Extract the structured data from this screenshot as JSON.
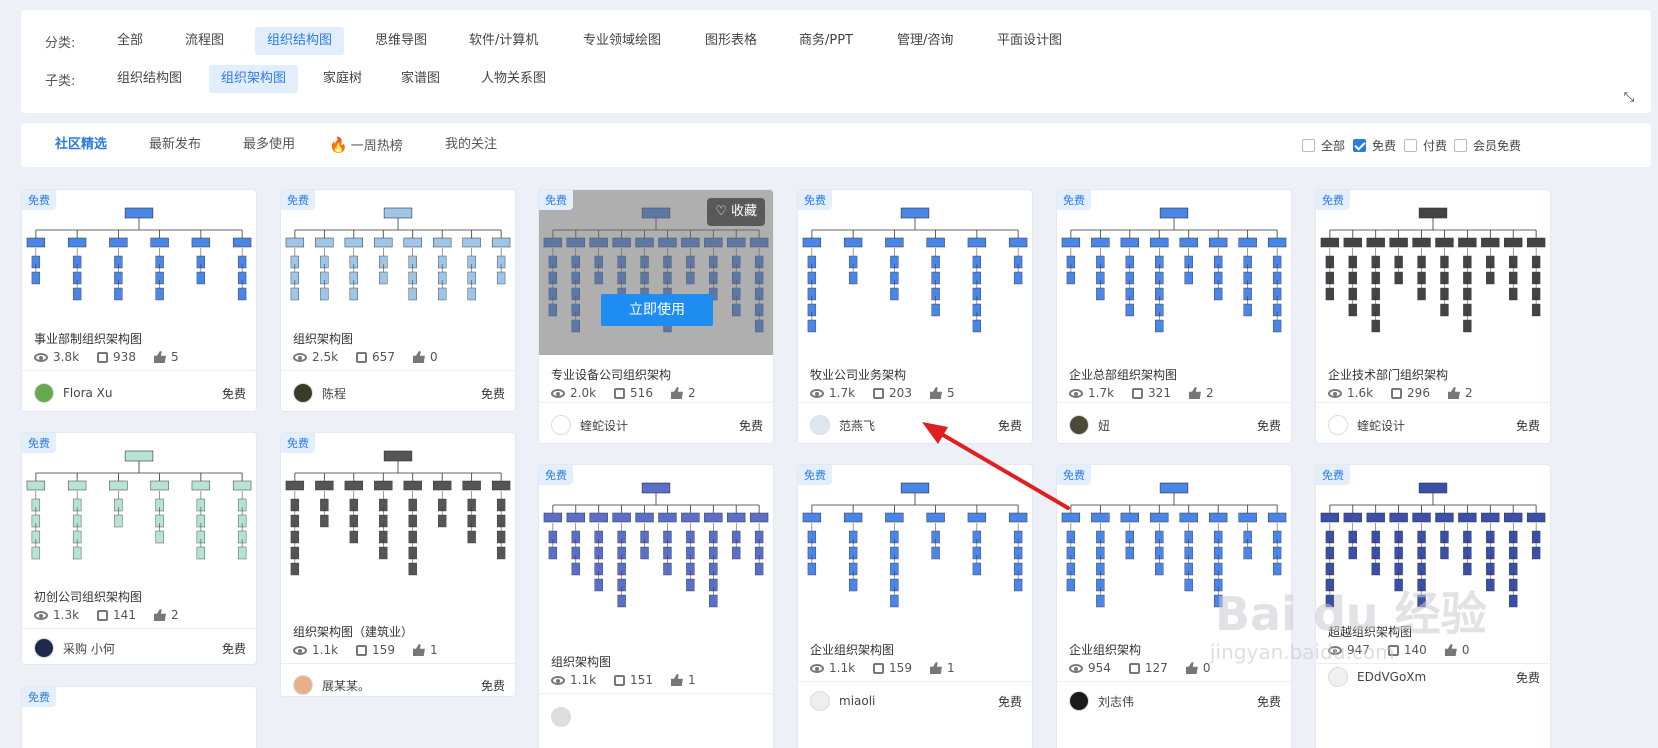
{
  "filter": {
    "category_label": "分类:",
    "categories": [
      "全部",
      "流程图",
      "组织结构图",
      "思维导图",
      "软件/计算机",
      "专业领域绘图",
      "图形表格",
      "商务/PPT",
      "管理/咨询",
      "平面设计图"
    ],
    "sub_label": "子类:",
    "subcategories": [
      "组织结构图",
      "组织架构图",
      "家庭树",
      "家谱图",
      "人物关系图"
    ]
  },
  "tabs": [
    "社区精选",
    "最新发布",
    "最多使用",
    "一周热榜",
    "我的关注"
  ],
  "checks": [
    {
      "label": "全部",
      "checked": false
    },
    {
      "label": "免费",
      "checked": true
    },
    {
      "label": "付费",
      "checked": false
    },
    {
      "label": "会员免费",
      "checked": false
    }
  ],
  "badge": "免费",
  "hover": {
    "use": "立即使用",
    "fav": "收藏"
  },
  "cards": [
    {
      "title": "事业部制组织架构图",
      "views": "3.8k",
      "copies": "938",
      "likes": "5",
      "author": "Flora Xu",
      "price": "免费",
      "avatar_color": "#6aa84f"
    },
    {
      "title": "组织架构图",
      "views": "2.5k",
      "copies": "657",
      "likes": "0",
      "author": "陈程",
      "price": "免费",
      "avatar_color": "#3b3b2a"
    },
    {
      "title": "专业设备公司组织架构",
      "views": "2.0k",
      "copies": "516",
      "likes": "2",
      "author": "蝰蛇设计",
      "price": "免费",
      "avatar_color": "#ffffff"
    },
    {
      "title": "牧业公司业务架构",
      "views": "1.7k",
      "copies": "203",
      "likes": "5",
      "author": "范燕飞",
      "price": "免费",
      "avatar_color": "#dfe7ee"
    },
    {
      "title": "企业总部组织架构图",
      "views": "1.7k",
      "copies": "321",
      "likes": "2",
      "author": "妞",
      "price": "免费",
      "avatar_color": "#4a4a38"
    },
    {
      "title": "企业技术部门组织架构",
      "views": "1.6k",
      "copies": "296",
      "likes": "2",
      "author": "蝰蛇设计",
      "price": "免费",
      "avatar_color": "#ffffff"
    },
    {
      "title": "初创公司组织架构图",
      "views": "1.3k",
      "copies": "141",
      "likes": "2",
      "author": "采购 小何",
      "price": "免费",
      "avatar_color": "#1d2a4d"
    },
    {
      "title": "组织架构图（建筑业）",
      "views": "1.1k",
      "copies": "159",
      "likes": "1",
      "author": "展某某。",
      "price": "免费",
      "avatar_color": "#e8b08a"
    },
    {
      "title": "组织架构图",
      "views": "1.1k",
      "copies": "151",
      "likes": "1",
      "author": "",
      "price": "",
      "avatar_color": "#dddddd"
    },
    {
      "title": "企业组织架构图",
      "views": "1.1k",
      "copies": "159",
      "likes": "1",
      "author": "miaoli",
      "price": "免费",
      "avatar_color": "#eeeeee"
    },
    {
      "title": "企业组织架构",
      "views": "954",
      "copies": "127",
      "likes": "0",
      "author": "刘志伟",
      "price": "免费",
      "avatar_color": "#1a1a1a"
    },
    {
      "title": "超越组织架构图",
      "views": "947",
      "copies": "140",
      "likes": "0",
      "author": "EDdVGoXm",
      "price": "免费",
      "avatar_color": "#f0f0f0"
    }
  ],
  "watermark": {
    "main": "Bai du 经验",
    "sub": "jingyan.baidu.com"
  },
  "colors": {
    "accent": "#2b7be5",
    "arrow": "#e02020",
    "chart_blue": "#4a86e8"
  }
}
